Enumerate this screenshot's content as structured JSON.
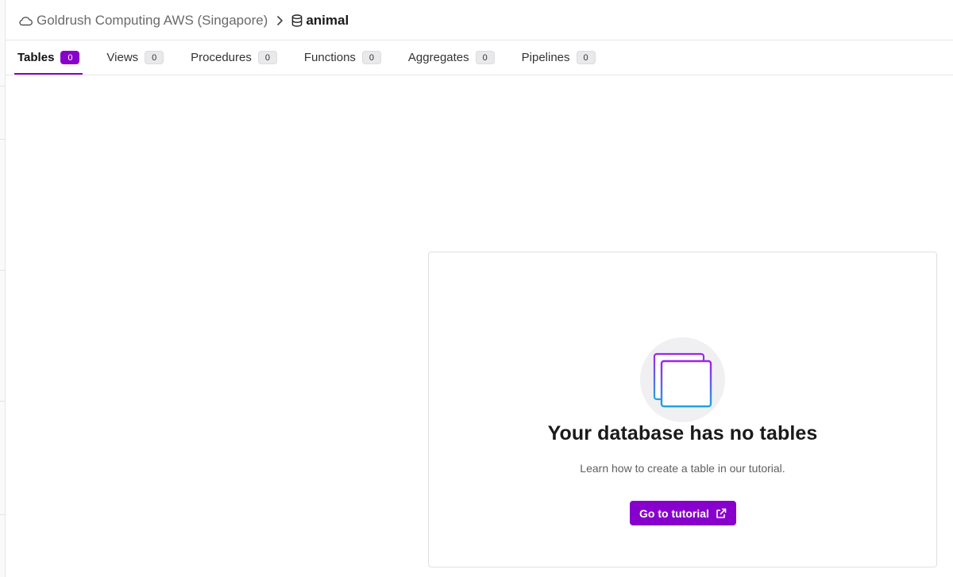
{
  "breadcrumb": {
    "workspace_icon": "cloud-icon",
    "workspace": "Goldrush Computing AWS (Singapore)",
    "separator_icon": "chevron-right-icon",
    "database_icon": "database-icon",
    "database": "animal"
  },
  "tabs": [
    {
      "label": "Tables",
      "count": "0",
      "active": true
    },
    {
      "label": "Views",
      "count": "0",
      "active": false
    },
    {
      "label": "Procedures",
      "count": "0",
      "active": false
    },
    {
      "label": "Functions",
      "count": "0",
      "active": false
    },
    {
      "label": "Aggregates",
      "count": "0",
      "active": false
    },
    {
      "label": "Pipelines",
      "count": "0",
      "active": false
    }
  ],
  "empty_state": {
    "illustration_icon": "tables-stack-icon",
    "title": "Your database has no tables",
    "subtitle": "Learn how to create a table in our tutorial.",
    "button_label": "Go to tutorial",
    "button_icon": "external-link-icon"
  },
  "colors": {
    "accent": "#8800cc",
    "illustration_gradient_start": "#a020f0",
    "illustration_gradient_end": "#1fa3e0"
  }
}
